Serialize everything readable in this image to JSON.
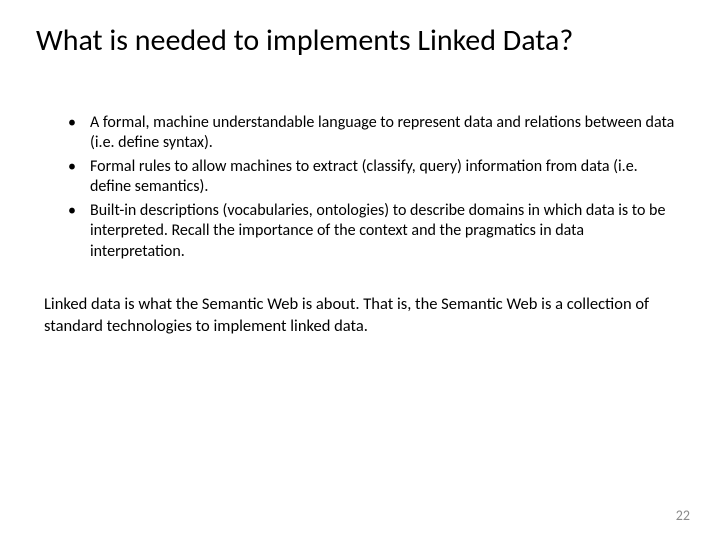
{
  "title": "What is needed to implements Linked Data?",
  "bullets": [
    "A formal, machine understandable language to represent data and relations between data (i.e. define syntax).",
    "Formal rules to allow machines to extract (classify, query) information from data (i.e. define semantics).",
    "Built-in descriptions (vocabularies, ontologies) to describe domains in which data is to be interpreted. Recall the importance of the context and the pragmatics in data interpretation."
  ],
  "paragraph": "Linked data is what the Semantic Web is about. That is, the Semantic Web is a collection of standard technologies to implement linked data.",
  "page_number": "22"
}
